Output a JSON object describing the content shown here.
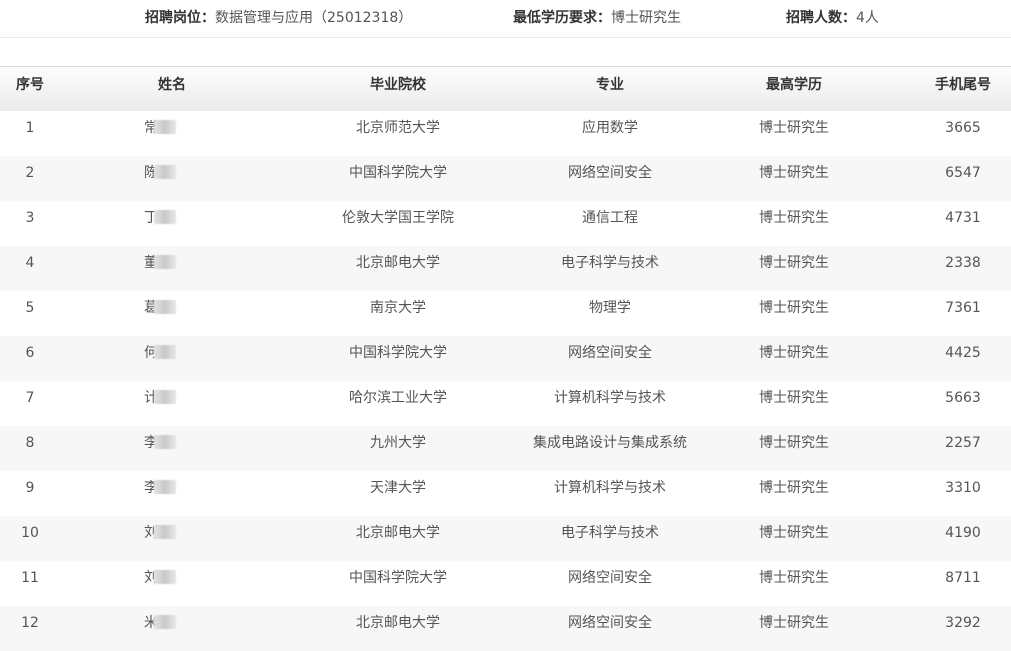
{
  "header": {
    "post_label": "招聘岗位：",
    "post_value": "数据管理与应用（25012318）",
    "edu_label": "最低学历要求：",
    "edu_value": "博士研究生",
    "count_label": "招聘人数：",
    "count_value": "4人"
  },
  "table": {
    "columns": [
      "序号",
      "姓名",
      "毕业院校",
      "专业",
      "最高学历",
      "手机尾号"
    ],
    "rows": [
      {
        "idx": "1",
        "name": "常",
        "school": "北京师范大学",
        "major": "应用数学",
        "degree": "博士研究生",
        "phone": "3665"
      },
      {
        "idx": "2",
        "name": "陈",
        "school": "中国科学院大学",
        "major": "网络空间安全",
        "degree": "博士研究生",
        "phone": "6547"
      },
      {
        "idx": "3",
        "name": "丁",
        "school": "伦敦大学国王学院",
        "major": "通信工程",
        "degree": "博士研究生",
        "phone": "4731"
      },
      {
        "idx": "4",
        "name": "董",
        "school": "北京邮电大学",
        "major": "电子科学与技术",
        "degree": "博士研究生",
        "phone": "2338"
      },
      {
        "idx": "5",
        "name": "葛",
        "school": "南京大学",
        "major": "物理学",
        "degree": "博士研究生",
        "phone": "7361"
      },
      {
        "idx": "6",
        "name": "何",
        "school": "中国科学院大学",
        "major": "网络空间安全",
        "degree": "博士研究生",
        "phone": "4425"
      },
      {
        "idx": "7",
        "name": "计",
        "school": "哈尔滨工业大学",
        "major": "计算机科学与技术",
        "degree": "博士研究生",
        "phone": "5663"
      },
      {
        "idx": "8",
        "name": "李",
        "school": "九州大学",
        "major": "集成电路设计与集成系统",
        "degree": "博士研究生",
        "phone": "2257"
      },
      {
        "idx": "9",
        "name": "李",
        "school": "天津大学",
        "major": "计算机科学与技术",
        "degree": "博士研究生",
        "phone": "3310"
      },
      {
        "idx": "10",
        "name": "刘",
        "school": "北京邮电大学",
        "major": "电子科学与技术",
        "degree": "博士研究生",
        "phone": "4190"
      },
      {
        "idx": "11",
        "name": "刘",
        "school": "中国科学院大学",
        "major": "网络空间安全",
        "degree": "博士研究生",
        "phone": "8711"
      },
      {
        "idx": "12",
        "name": "米",
        "school": "北京邮电大学",
        "major": "网络空间安全",
        "degree": "博士研究生",
        "phone": "3292"
      }
    ]
  }
}
